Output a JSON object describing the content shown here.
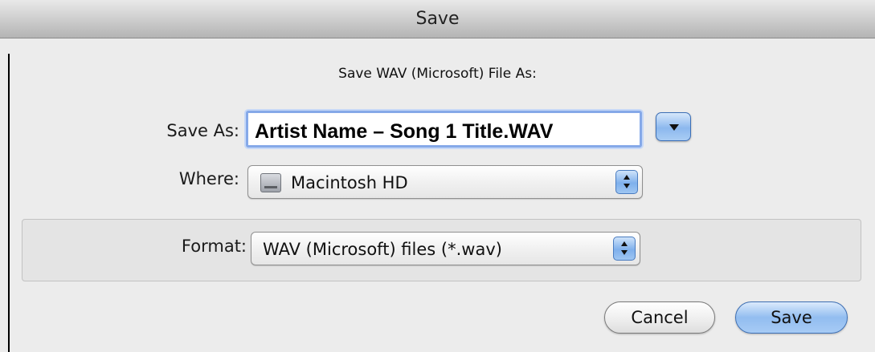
{
  "window": {
    "title": "Save"
  },
  "dialog": {
    "prompt": "Save WAV (Microsoft) File As:",
    "save_as": {
      "label": "Save As:",
      "value": "Artist Name – Song 1 Title.WAV",
      "expand_icon": "triangle-down-icon"
    },
    "where": {
      "label": "Where:",
      "value": "Macintosh HD",
      "icon": "hard-drive-icon"
    },
    "format": {
      "label": "Format:",
      "value": "WAV (Microsoft) files (*.wav)"
    },
    "buttons": {
      "cancel": "Cancel",
      "save": "Save"
    }
  },
  "colors": {
    "accent_blue": "#8cb8ee",
    "focus_ring": "#86a9e8",
    "window_bg": "#ececec"
  }
}
